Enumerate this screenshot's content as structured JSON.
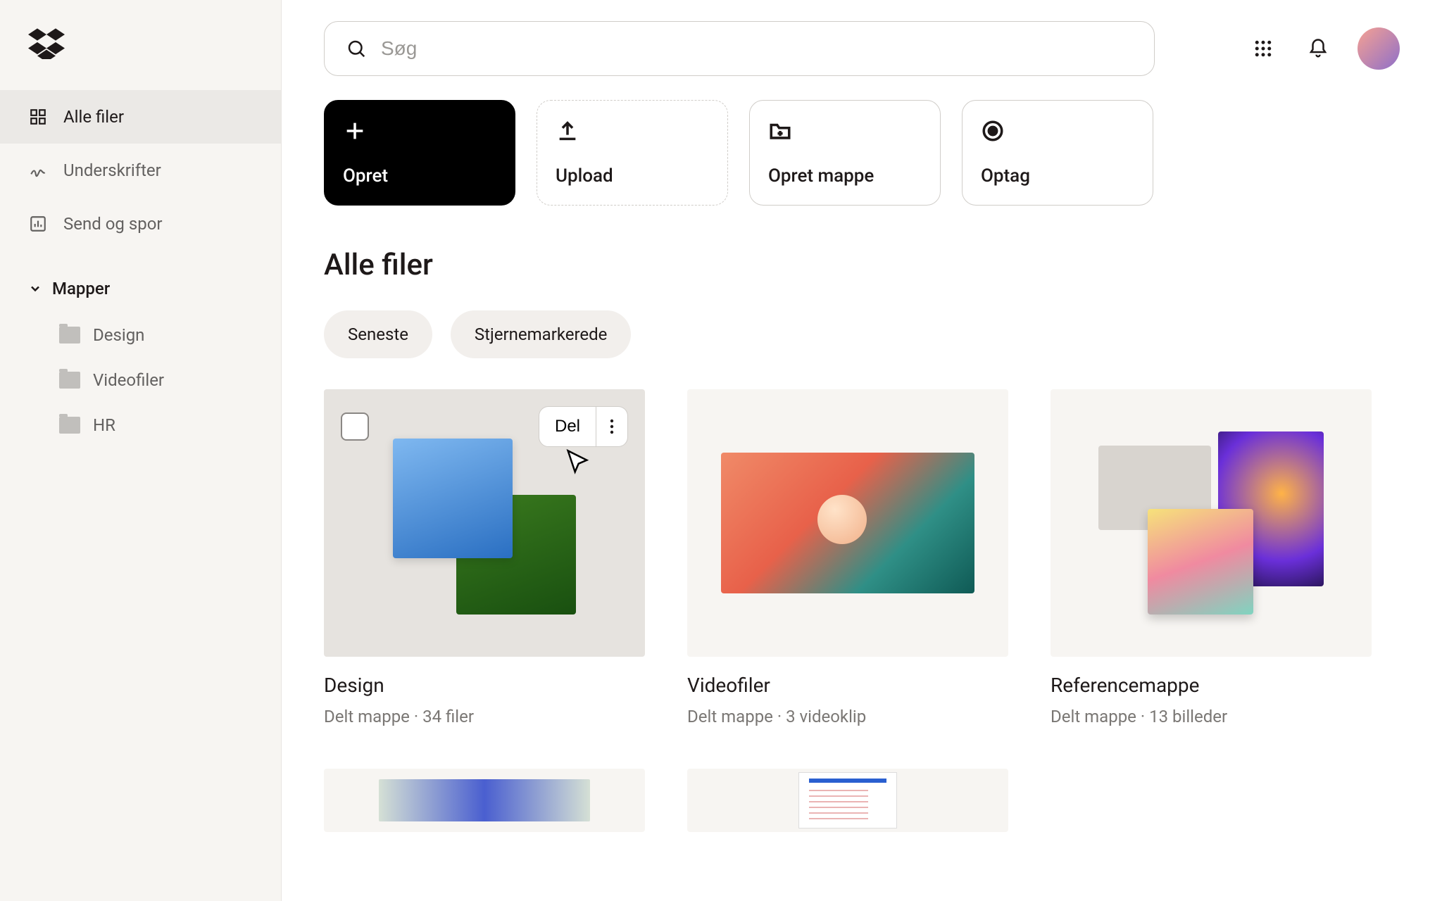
{
  "search": {
    "placeholder": "Søg"
  },
  "sidebar": {
    "nav": [
      {
        "label": "Alle filer",
        "icon": "grid-icon",
        "active": true
      },
      {
        "label": "Underskrifter",
        "icon": "signature-icon",
        "active": false
      },
      {
        "label": "Send og spor",
        "icon": "analytics-icon",
        "active": false
      }
    ],
    "folders_label": "Mapper",
    "folders": [
      {
        "label": "Design"
      },
      {
        "label": "Videofiler"
      },
      {
        "label": "HR"
      }
    ]
  },
  "actions": {
    "create": "Opret",
    "upload": "Upload",
    "create_folder": "Opret mappe",
    "record": "Optag"
  },
  "page_title": "Alle filer",
  "chips": {
    "recent": "Seneste",
    "starred": "Stjernemarkerede"
  },
  "hover": {
    "share": "Del"
  },
  "items": [
    {
      "title": "Design",
      "meta": "Delt mappe · 34 filer"
    },
    {
      "title": "Videofiler",
      "meta": "Delt mappe · 3 videoklip"
    },
    {
      "title": "Referencemappe",
      "meta": "Delt mappe · 13 billeder"
    }
  ]
}
